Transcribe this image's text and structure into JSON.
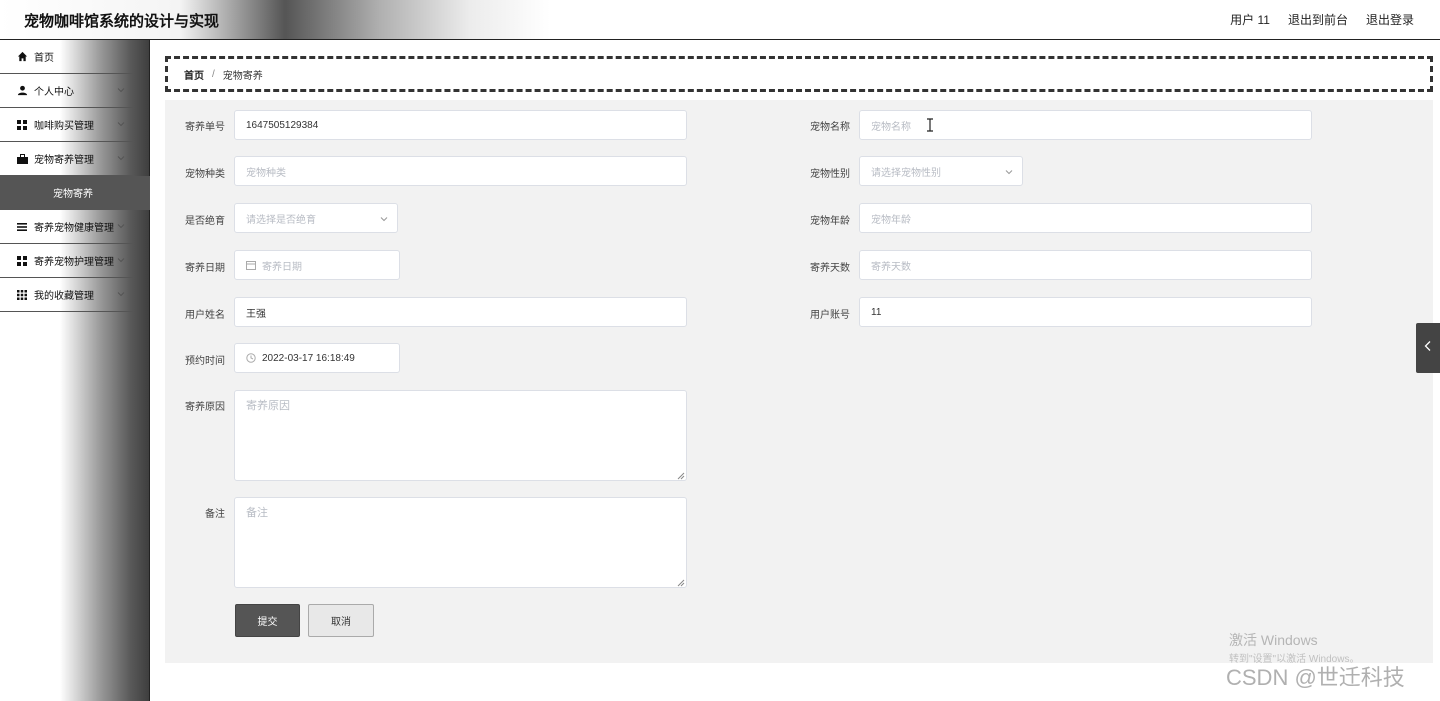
{
  "header": {
    "app_title": "宠物咖啡馆系统的设计与实现",
    "user_label": "用户 11",
    "back_to_front": "退出到前台",
    "logout": "退出登录"
  },
  "sidebar": {
    "items": [
      {
        "label": "首页",
        "icon": "home-icon"
      },
      {
        "label": "个人中心",
        "icon": "user-icon"
      },
      {
        "label": "咖啡购买管理",
        "icon": "grid-icon"
      },
      {
        "label": "宠物寄养管理",
        "icon": "briefcase-icon"
      },
      {
        "label": "寄养宠物健康管理",
        "icon": "list-icon"
      },
      {
        "label": "寄养宠物护理管理",
        "icon": "grid-icon"
      },
      {
        "label": "我的收藏管理",
        "icon": "apps-icon"
      }
    ],
    "active_submenu": "宠物寄养"
  },
  "breadcrumb": {
    "home": "首页",
    "separator": "/",
    "current": "宠物寄养"
  },
  "form": {
    "order_no": {
      "label": "寄养单号",
      "value": "1647505129384"
    },
    "pet_name": {
      "label": "宠物名称",
      "placeholder": "宠物名称"
    },
    "pet_species": {
      "label": "宠物种类",
      "placeholder": "宠物种类"
    },
    "pet_gender": {
      "label": "宠物性别",
      "placeholder": "请选择宠物性别"
    },
    "sterilized": {
      "label": "是否绝育",
      "placeholder": "请选择是否绝育"
    },
    "pet_age": {
      "label": "宠物年龄",
      "placeholder": "宠物年龄"
    },
    "foster_date": {
      "label": "寄养日期",
      "placeholder": "寄养日期"
    },
    "foster_days": {
      "label": "寄养天数",
      "placeholder": "寄养天数"
    },
    "user_name": {
      "label": "用户姓名",
      "value": "王强"
    },
    "user_account": {
      "label": "用户账号",
      "value": "11"
    },
    "reserve_time": {
      "label": "预约时间",
      "value": "2022-03-17 16:18:49"
    },
    "foster_reason": {
      "label": "寄养原因",
      "placeholder": "寄养原因"
    },
    "remark": {
      "label": "备注",
      "placeholder": "备注"
    },
    "submit_label": "提交",
    "cancel_label": "取消"
  },
  "watermarks": {
    "windows_title": "激活 Windows",
    "windows_sub": "转到\"设置\"以激活 Windows。",
    "csdn": "CSDN @世迁科技"
  },
  "colors": {
    "accent": "#555555",
    "panel_bg": "#f2f2f2",
    "border": "#dcdfe6",
    "placeholder": "#b8bcc4"
  }
}
